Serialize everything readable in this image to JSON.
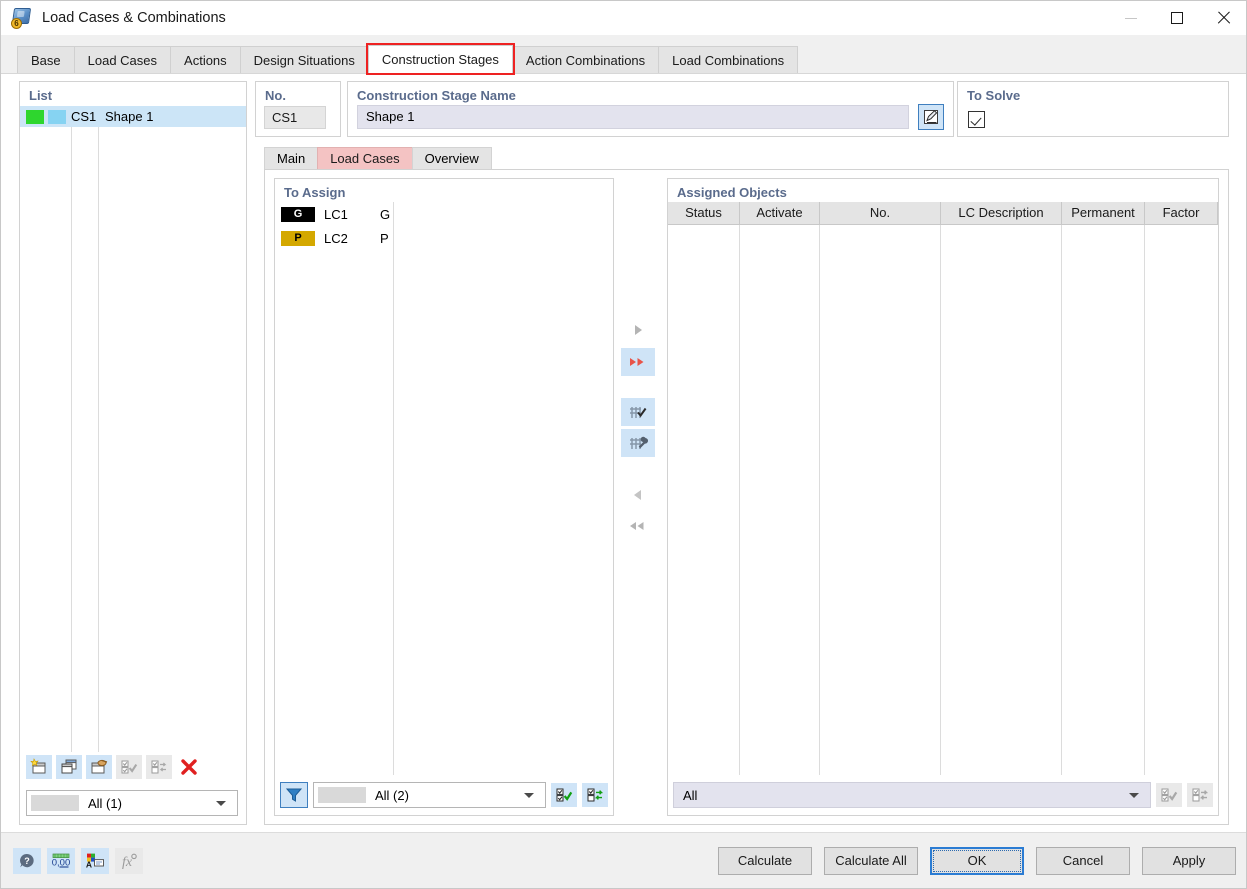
{
  "window": {
    "title": "Load Cases & Combinations",
    "icon": "load-cases-cube-icon",
    "minimize": "−",
    "maximize": "□",
    "close": "✕"
  },
  "tabs": [
    {
      "label": "Base",
      "active": false,
      "highlight": false
    },
    {
      "label": "Load Cases",
      "active": false,
      "highlight": false
    },
    {
      "label": "Actions",
      "active": false,
      "highlight": false
    },
    {
      "label": "Design Situations",
      "active": false,
      "highlight": false
    },
    {
      "label": "Construction Stages",
      "active": true,
      "highlight": true
    },
    {
      "label": "Action Combinations",
      "active": false,
      "highlight": false
    },
    {
      "label": "Load Combinations",
      "active": false,
      "highlight": false
    }
  ],
  "list_panel": {
    "title": "List",
    "rows": [
      {
        "color1": "#2ed62e",
        "color2": "#86d3f2",
        "no": "CS1",
        "name": "Shape 1",
        "selected": true
      }
    ],
    "toolbar": [
      {
        "name": "new-stage-button",
        "enabled": true
      },
      {
        "name": "copy-stage-button",
        "enabled": true
      },
      {
        "name": "import-stage-button",
        "enabled": true
      },
      {
        "name": "select-all-button",
        "enabled": false
      },
      {
        "name": "invert-selection-button",
        "enabled": false
      },
      {
        "name": "delete-button",
        "enabled": true
      }
    ],
    "filter_combo": {
      "value": "All (1)"
    }
  },
  "header": {
    "no_label": "No.",
    "no_value": "CS1",
    "name_label": "Construction Stage Name",
    "name_value": "Shape 1",
    "edit_button": "edit-pencil-icon",
    "to_solve_label": "To Solve",
    "to_solve_checked": true
  },
  "subtabs": [
    {
      "label": "Main",
      "active": false
    },
    {
      "label": "Load Cases",
      "active": true
    },
    {
      "label": "Overview",
      "active": false
    }
  ],
  "to_assign": {
    "title": "To Assign",
    "rows": [
      {
        "badge": "G",
        "badge_bg": "#000000",
        "badge_fg": "#ffffff",
        "lc": "LC1",
        "desc": "G"
      },
      {
        "badge": "P",
        "badge_bg": "#d4a800",
        "badge_fg": "#000000",
        "lc": "LC2",
        "desc": "P"
      }
    ],
    "filter_icon": "funnel-filter-icon",
    "filter_combo": {
      "value": "All (2)"
    },
    "select_all_icon": "select-all-icon",
    "invert_selection_icon": "invert-selection-icon"
  },
  "transfer_buttons": [
    {
      "name": "assign-single-button",
      "glyph": "▶",
      "enabled": false,
      "highlighted": false
    },
    {
      "name": "assign-all-button",
      "glyph": "▶▶",
      "enabled": true,
      "highlighted": true
    },
    {
      "name": "assign-table-check-button",
      "glyph": "table-check-icon",
      "enabled": true,
      "highlighted": true
    },
    {
      "name": "assign-table-settings-button",
      "glyph": "table-wrench-icon",
      "enabled": true,
      "highlighted": true
    },
    {
      "name": "unassign-single-button",
      "glyph": "◀",
      "enabled": false,
      "highlighted": false
    },
    {
      "name": "unassign-all-button",
      "glyph": "◀◀",
      "enabled": false,
      "highlighted": false
    }
  ],
  "assigned_objects": {
    "title": "Assigned Objects",
    "columns": [
      "Status",
      "Activate",
      "No.",
      "LC Description",
      "Permanent",
      "Factor"
    ],
    "rows": [],
    "filter_combo": {
      "value": "All"
    },
    "select_all_icon": "select-all-icon",
    "invert_selection_icon": "invert-selection-icon"
  },
  "footer": {
    "icons": [
      {
        "name": "help-button",
        "enabled": true
      },
      {
        "name": "decimal-places-button",
        "enabled": true
      },
      {
        "name": "color-settings-button",
        "enabled": true
      },
      {
        "name": "formula-button",
        "enabled": false
      }
    ],
    "buttons": [
      {
        "label": "Calculate",
        "focus": false
      },
      {
        "label": "Calculate All",
        "focus": false
      },
      {
        "label": "OK",
        "focus": true
      },
      {
        "label": "Cancel",
        "focus": false
      },
      {
        "label": "Apply",
        "focus": false
      }
    ]
  }
}
